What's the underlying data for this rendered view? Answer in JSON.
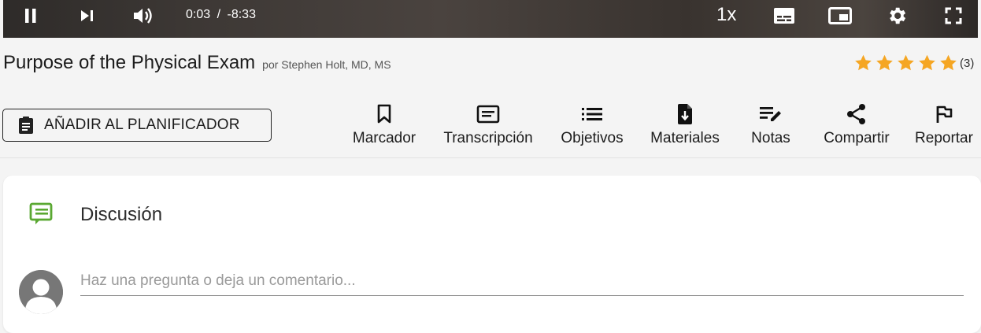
{
  "player": {
    "time_current": "0:03",
    "time_separator": "/",
    "time_remaining": "-8:33",
    "speed": "1x",
    "icons": [
      "pause-icon",
      "skip-next-icon",
      "volume-icon",
      "captions-icon",
      "picture-in-picture-icon",
      "settings-icon",
      "fullscreen-icon"
    ]
  },
  "video": {
    "title": "Purpose of the Physical Exam",
    "author": "por Stephen Holt, MD, MS",
    "rating_stars": 5,
    "rating_count": "(3)",
    "star_color": "#f5a623"
  },
  "toolbar": {
    "planner_label": "AÑADIR AL PLANIFICADOR",
    "actions": [
      {
        "label": "Marcador",
        "icon": "bookmark-icon"
      },
      {
        "label": "Transcripción",
        "icon": "transcript-icon"
      },
      {
        "label": "Objetivos",
        "icon": "list-icon"
      },
      {
        "label": "Materiales",
        "icon": "download-file-icon"
      },
      {
        "label": "Notas",
        "icon": "edit-note-icon"
      },
      {
        "label": "Compartir",
        "icon": "share-icon"
      },
      {
        "label": "Reportar",
        "icon": "flag-icon"
      }
    ]
  },
  "discussion": {
    "title": "Discusión",
    "accent_color": "#5aa832",
    "placeholder": "Haz una pregunta o deja un comentario..."
  }
}
